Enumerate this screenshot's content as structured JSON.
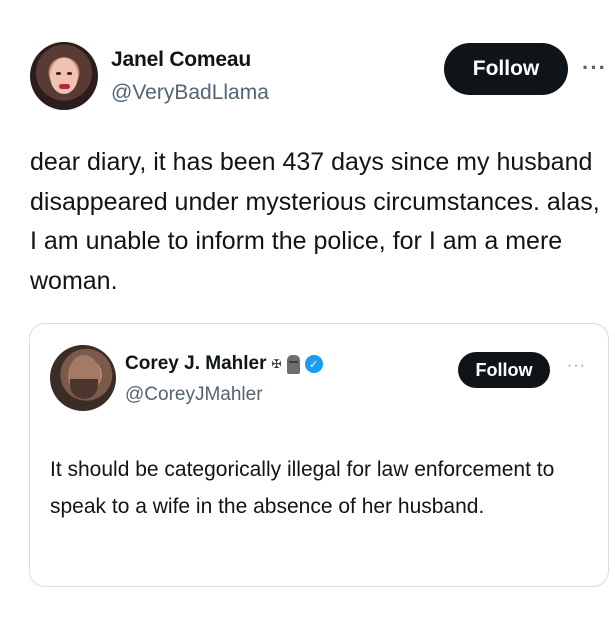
{
  "author": {
    "name": "Janel Comeau",
    "handle": "@VeryBadLlama",
    "follow_label": "Follow",
    "more_label": "···"
  },
  "tweet_text": "dear diary, it has been 437 days since my husband disappeared under mysterious circumstances. alas, I am unable to inform the police, for I am a mere woman.",
  "quote": {
    "name": "Corey J. Mahler",
    "name_icons": [
      "cross-icon",
      "moai-icon",
      "verified-badge-icon"
    ],
    "cross_glyph": "✠",
    "verified_glyph": "✓",
    "handle": "@CoreyJMahler",
    "follow_label": "Follow",
    "more_label": "···",
    "text": "It should be categorically illegal for law enforcement to speak to a wife in the absence of her husband."
  },
  "colors": {
    "button_bg": "#0f1419",
    "handle_gray": "#536471",
    "verified_blue": "#1d9bf0",
    "card_border": "#d7dde2"
  }
}
